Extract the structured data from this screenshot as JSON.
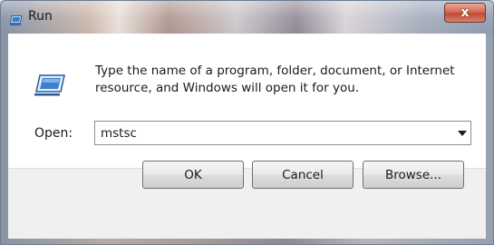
{
  "window": {
    "title": "Run",
    "close_label": "x",
    "icon": "run-icon"
  },
  "dialog": {
    "icon": "run-icon",
    "message_line1": "Type the name of a program, folder, document, or Internet",
    "message_line2": "resource, and Windows will open it for you.",
    "open_label": "Open:",
    "open_value": "mstsc"
  },
  "buttons": {
    "ok": "OK",
    "cancel": "Cancel",
    "browse": "Browse..."
  }
}
